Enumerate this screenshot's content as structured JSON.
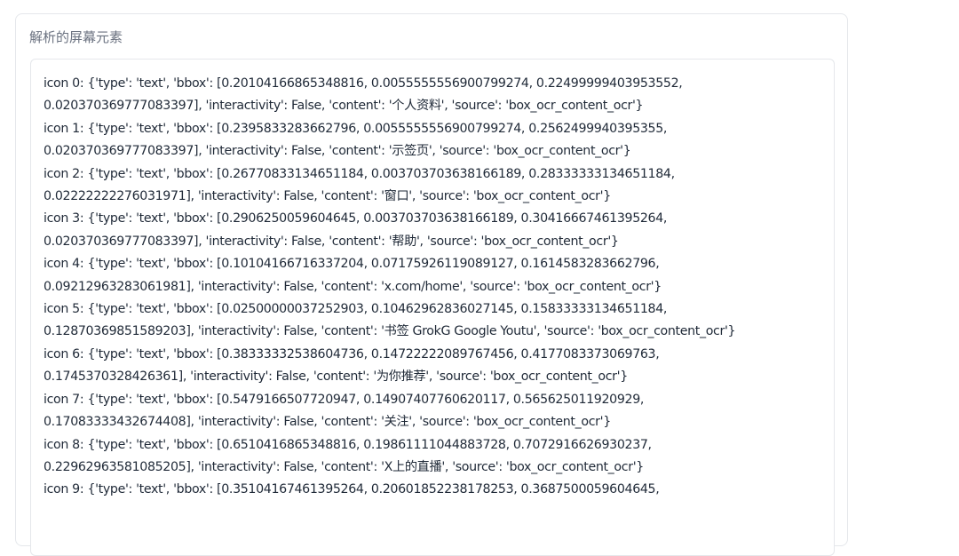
{
  "panel": {
    "title": "解析的屏幕元素"
  },
  "output": {
    "lines": [
      "icon 0: {'type': 'text', 'bbox': [0.20104166865348816, 0.0055555556900799274, 0.22499999403953552,",
      "0.020370369777083397], 'interactivity': False, 'content': '个人资料', 'source': 'box_ocr_content_ocr'}",
      "icon 1: {'type': 'text', 'bbox': [0.2395833283662796, 0.0055555556900799274, 0.2562499940395355,",
      "0.020370369777083397], 'interactivity': False, 'content': '示签页', 'source': 'box_ocr_content_ocr'}",
      "icon 2: {'type': 'text', 'bbox': [0.26770833134651184, 0.003703703638166189, 0.28333333134651184,",
      "0.02222222276031971], 'interactivity': False, 'content': '窗口', 'source': 'box_ocr_content_ocr'}",
      "icon 3: {'type': 'text', 'bbox': [0.2906250059604645, 0.003703703638166189, 0.30416667461395264,",
      "0.020370369777083397], 'interactivity': False, 'content': '帮助', 'source': 'box_ocr_content_ocr'}",
      "icon 4: {'type': 'text', 'bbox': [0.10104166716337204, 0.07175926119089127, 0.1614583283662796,",
      "0.09212963283061981], 'interactivity': False, 'content': 'x.com/home', 'source': 'box_ocr_content_ocr'}",
      "icon 5: {'type': 'text', 'bbox': [0.02500000037252903, 0.10462962836027145, 0.15833333134651184,",
      "0.12870369851589203], 'interactivity': False, 'content': '书签 GrokG Google Youtu', 'source': 'box_ocr_content_ocr'}",
      "icon 6: {'type': 'text', 'bbox': [0.38333332538604736, 0.14722222089767456, 0.4177083373069763,",
      "0.1745370328426361], 'interactivity': False, 'content': '为你推荐', 'source': 'box_ocr_content_ocr'}",
      "icon 7: {'type': 'text', 'bbox': [0.5479166507720947, 0.14907407760620117, 0.565625011920929,",
      "0.17083333432674408], 'interactivity': False, 'content': '关注', 'source': 'box_ocr_content_ocr'}",
      "icon 8: {'type': 'text', 'bbox': [0.6510416865348816, 0.19861111044883728, 0.7072916626930237,",
      "0.22962963581085205], 'interactivity': False, 'content': 'X上的直播', 'source': 'box_ocr_content_ocr'}",
      "icon 9: {'type': 'text', 'bbox': [0.35104167461395264, 0.20601852238178253, 0.3687500059604645,"
    ]
  }
}
